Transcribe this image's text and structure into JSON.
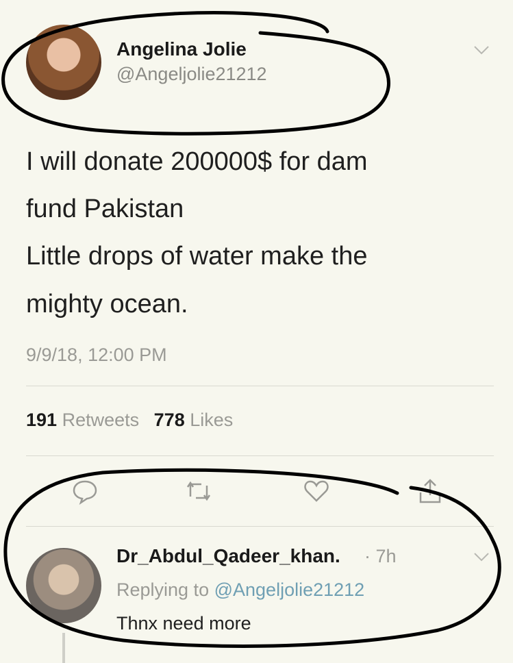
{
  "tweet": {
    "author_name": "Angelina Jolie",
    "author_handle": "@Angeljolie21212",
    "text_lines": [
      "I will donate 200000$ for dam",
      "fund Pakistan",
      "Little drops of water make the",
      "mighty ocean."
    ],
    "timestamp": "9/9/18, 12:00 PM",
    "retweets_count": "191",
    "retweets_label": "Retweets",
    "likes_count": "778",
    "likes_label": "Likes"
  },
  "actions": [
    "reply-icon",
    "retweet-icon",
    "like-icon",
    "share-icon"
  ],
  "reply": {
    "author_name": "Dr_Abdul_Qadeer_khan.",
    "time": "· 7h",
    "replying_prefix": "Replying to",
    "replying_handle": "@Angeljolie21212",
    "text": "Thnx need more"
  },
  "colors": {
    "background": "#f7f7ee",
    "muted_text": "#9a9a95",
    "mention": "#6f9fb3",
    "ink": "#000000"
  }
}
